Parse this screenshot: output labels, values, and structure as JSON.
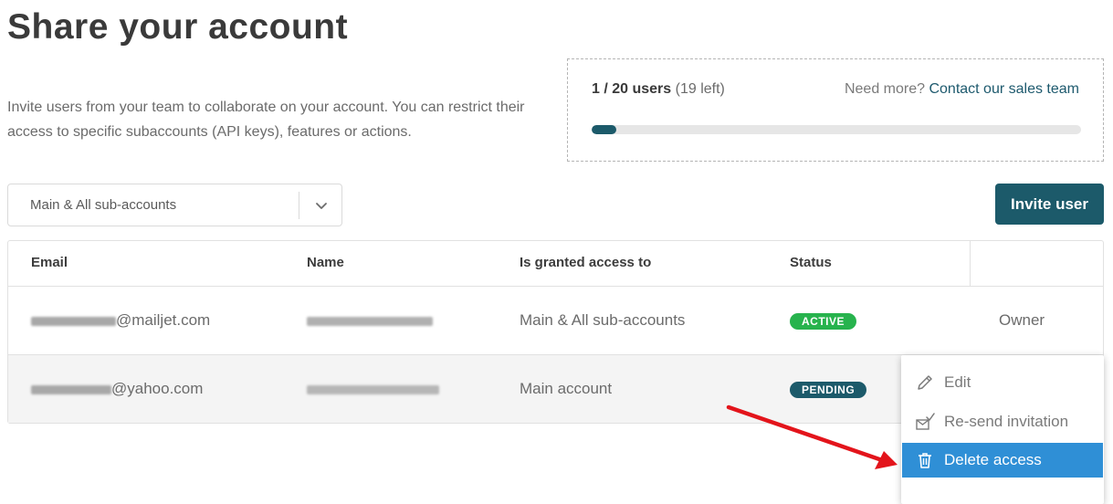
{
  "page": {
    "title": "Share your account",
    "intro": "Invite users from your team to collaborate on your account. You can restrict their access to specific subaccounts (API keys), features or actions."
  },
  "quota": {
    "used_total": "1 / 20 users",
    "left": "(19 left)",
    "need_more": "Need more?",
    "contact_link": "Contact our sales team",
    "fill_fraction": 0.05
  },
  "filter": {
    "selected": "Main & All sub-accounts"
  },
  "actions": {
    "invite_label": "Invite user"
  },
  "table": {
    "headers": {
      "email": "Email",
      "name": "Name",
      "access": "Is granted access to",
      "status": "Status"
    },
    "rows": [
      {
        "email_domain": "@mailjet.com",
        "access": "Main & All sub-accounts",
        "status": "ACTIVE",
        "role": "Owner"
      },
      {
        "email_domain": "@yahoo.com",
        "access": "Main account",
        "status": "PENDING"
      }
    ]
  },
  "context_menu": {
    "items": [
      {
        "label": "Edit",
        "icon": "pencil-icon"
      },
      {
        "label": "Re-send invitation",
        "icon": "envelope-check-icon"
      },
      {
        "label": "Delete access",
        "icon": "trash-icon"
      }
    ]
  },
  "colors": {
    "brand": "#1c5a6a",
    "active": "#27b34d",
    "highlight": "#2f8fd6",
    "annotation_arrow": "#e3141b"
  }
}
